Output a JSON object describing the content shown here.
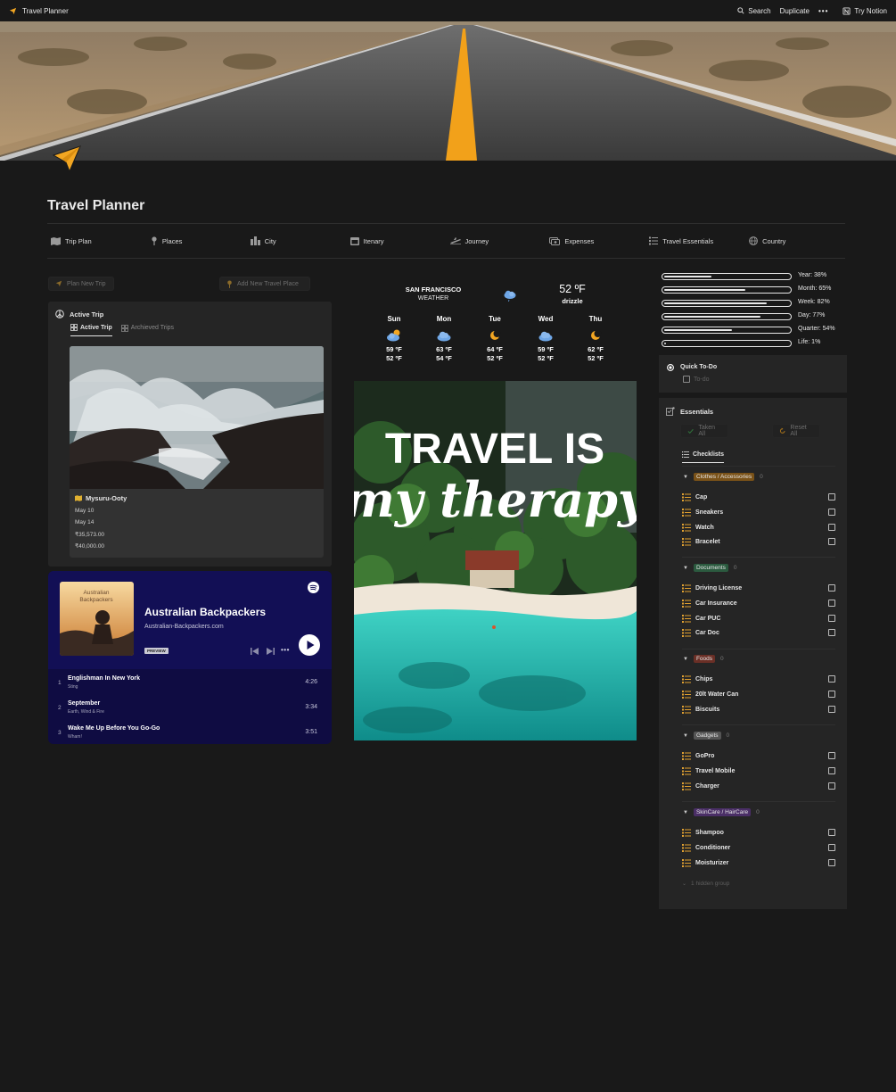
{
  "topbar": {
    "page_title": "Travel Planner",
    "search": "Search",
    "duplicate": "Duplicate",
    "more": "•••",
    "try_notion": "Try Notion"
  },
  "page": {
    "title": "Travel Planner"
  },
  "nav": [
    {
      "label": "Trip Plan",
      "icon": "map-icon"
    },
    {
      "label": "Places",
      "icon": "pin-icon"
    },
    {
      "label": "City",
      "icon": "city-icon"
    },
    {
      "label": "Itenary",
      "icon": "calendar-icon"
    },
    {
      "label": "Journey",
      "icon": "plane-icon"
    },
    {
      "label": "Expenses",
      "icon": "money-icon"
    },
    {
      "label": "Travel Essentials",
      "icon": "checklist-icon"
    },
    {
      "label": "Country",
      "icon": "globe-icon"
    }
  ],
  "buttons": {
    "plan_new_trip": "Plan New Trip",
    "add_new_place": "Add New Travel Place"
  },
  "active_trip": {
    "heading": "Active Trip",
    "tabs": [
      "Active Trip",
      "Archieved Trips"
    ],
    "card": {
      "title": "Mysuru-Ooty",
      "start": "May 10",
      "end": "May 14",
      "spent": "₹35,573.00",
      "budget": "₹40,000.00"
    }
  },
  "spotify": {
    "art_text": "Australian\nBackpackers",
    "art_line1": "Australian",
    "art_line2": "Backpackers",
    "title": "Australian Backpackers",
    "subtitle": "Australian-Backpackers.com",
    "preview": "PREVIEW",
    "more": "•••",
    "tracks": [
      {
        "num": "1",
        "name": "Englishman In New York",
        "artist": "Sting",
        "duration": "4:26"
      },
      {
        "num": "2",
        "name": "September",
        "artist": "Earth, Wind & Fire",
        "duration": "3:34"
      },
      {
        "num": "3",
        "name": "Wake Me Up Before You Go-Go",
        "artist": "Wham!",
        "duration": "3:51"
      }
    ]
  },
  "weather": {
    "city": "SAN FRANCISCO",
    "label": "WEATHER",
    "current_temp": "52 ºF",
    "condition": "drizzle",
    "days": [
      {
        "day": "Sun",
        "icon": "cloud-sun-icon",
        "hi": "59 ºF",
        "lo": "52 ºF"
      },
      {
        "day": "Mon",
        "icon": "cloud-icon",
        "hi": "63 ºF",
        "lo": "54 ºF"
      },
      {
        "day": "Tue",
        "icon": "moon-icon",
        "hi": "64 ºF",
        "lo": "52 ºF"
      },
      {
        "day": "Wed",
        "icon": "cloud-icon",
        "hi": "59 ºF",
        "lo": "52 ºF"
      },
      {
        "day": "Thu",
        "icon": "moon-icon",
        "hi": "62 ºF",
        "lo": "52 ºF"
      }
    ]
  },
  "poster": {
    "line1": "TRAVEL IS",
    "line2": "my therapy"
  },
  "progress": [
    {
      "label": "Year: 38%",
      "value": 0.38
    },
    {
      "label": "Month: 65%",
      "value": 0.65
    },
    {
      "label": "Week: 82%",
      "value": 0.82
    },
    {
      "label": "Day: 77%",
      "value": 0.77
    },
    {
      "label": "Quarter: 54%",
      "value": 0.54
    },
    {
      "label": "Life: 1%",
      "value": 0.01
    }
  ],
  "quick_todo": {
    "heading": "Quick To-Do",
    "placeholder": "To-do"
  },
  "essentials": {
    "heading": "Essentials",
    "taken_all": "Taken All",
    "reset_all": "Reset All",
    "view_tab": "Checklists",
    "groups": [
      {
        "name": "Clothes / Accessories",
        "count": "0",
        "color": "#7a5218",
        "items": [
          "Cap",
          "Sneakers",
          "Watch",
          "Bracelet"
        ]
      },
      {
        "name": "Documents",
        "count": "0",
        "color": "#2b5a3f",
        "items": [
          "Driving License",
          "Car Insurance",
          "Car PUC",
          "Car Doc"
        ]
      },
      {
        "name": "Foods",
        "count": "0",
        "color": "#6a2f26",
        "items": [
          "Chips",
          "20lt Water Can",
          "Biscuits"
        ]
      },
      {
        "name": "Gadgets",
        "count": "0",
        "color": "#555555",
        "items": [
          "GoPro",
          "Travel Mobile",
          "Charger"
        ]
      },
      {
        "name": "SkinCare / HairCare",
        "count": "0",
        "color": "#4a2e66",
        "items": [
          "Shampoo",
          "Conditioner",
          "Moisturizer"
        ]
      }
    ],
    "hidden": "1 hidden group"
  }
}
